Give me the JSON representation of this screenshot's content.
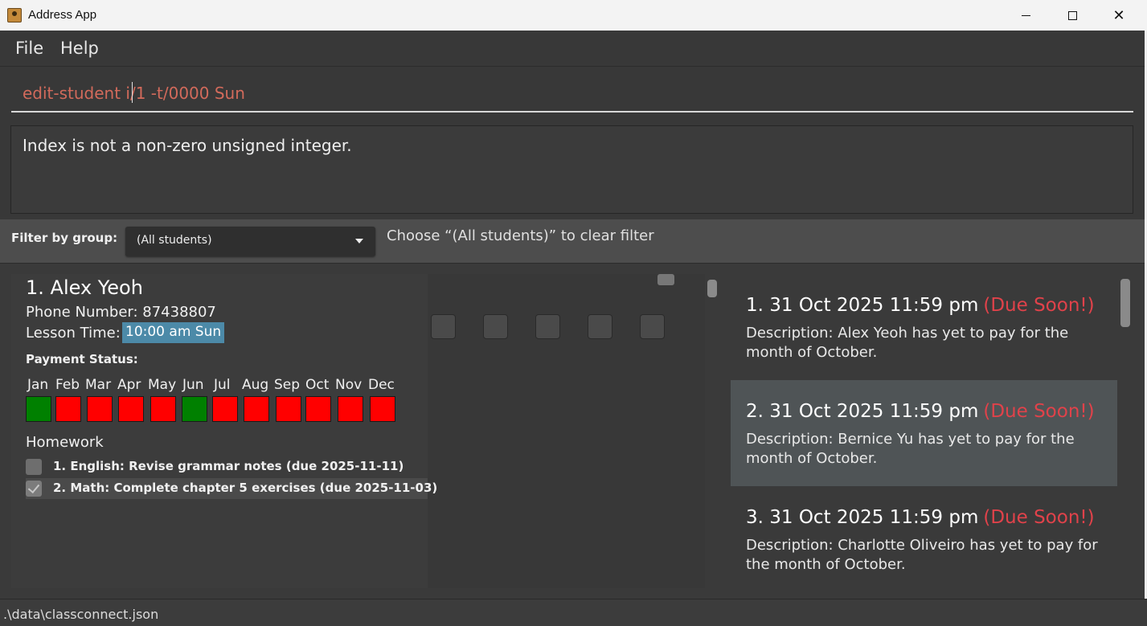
{
  "window": {
    "title": "Address App",
    "minimize_label": "—",
    "close_label": "✕"
  },
  "menu": {
    "file": "File",
    "help": "Help"
  },
  "command": {
    "value": "edit-student i/1 -t/0000 Sun"
  },
  "result": {
    "message": "Index is not a non-zero unsigned integer."
  },
  "filter": {
    "label": "Filter by group:",
    "selected": "(All students)",
    "hint": "Choose “(All students)” to clear filter"
  },
  "student": {
    "name": "1. Alex Yeoh",
    "phone": "Phone Number: 87438807",
    "lesson_label": "Lesson Time:",
    "lesson_time": "10:00 am Sun",
    "payment_label": "Payment Status:",
    "months": [
      {
        "name": "Jan",
        "paid": true
      },
      {
        "name": "Feb",
        "paid": false
      },
      {
        "name": "Mar",
        "paid": false
      },
      {
        "name": "Apr",
        "paid": false
      },
      {
        "name": "May",
        "paid": false
      },
      {
        "name": "Jun",
        "paid": true
      },
      {
        "name": "Jul",
        "paid": false
      },
      {
        "name": "Aug",
        "paid": false
      },
      {
        "name": "Sep",
        "paid": false
      },
      {
        "name": "Oct",
        "paid": false
      },
      {
        "name": "Nov",
        "paid": false
      },
      {
        "name": "Dec",
        "paid": false
      }
    ],
    "homework_label": "Homework",
    "homework": [
      {
        "text": "1. English: Revise grammar notes (due 2025-11-11)",
        "done": false
      },
      {
        "text": "2. Math: Complete chapter 5 exercises (due 2025-11-03)",
        "done": true
      }
    ]
  },
  "payments": [
    {
      "heading": "1. 31 Oct 2025 11:59 pm",
      "flag": "(Due Soon!)",
      "description": "Description: Alex Yeoh has yet to pay for the month of October."
    },
    {
      "heading": "2. 31 Oct 2025 11:59 pm",
      "flag": "(Due Soon!)",
      "description": "Description: Bernice Yu has yet to pay for the month of October."
    },
    {
      "heading": "3. 31 Oct 2025 11:59 pm",
      "flag": "(Due Soon!)",
      "description": "Description: Charlotte Oliveiro has yet to pay for the month of October."
    }
  ],
  "status": {
    "path": ".\\data\\classconnect.json"
  },
  "colors": {
    "paid": "#008000",
    "unpaid": "#ff0000",
    "due_soon": "#e0424a",
    "command_text": "#d26a5b",
    "lesson_tag": "#4c8aa8"
  }
}
